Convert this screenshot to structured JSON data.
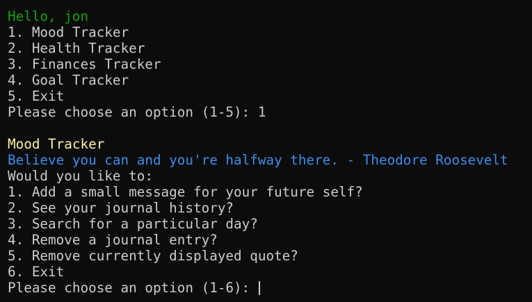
{
  "terminal": {
    "greeting": "Hello, jon",
    "main_menu": [
      "1. Mood Tracker",
      "2. Health Tracker",
      "3. Finances Tracker",
      "4. Goal Tracker",
      "5. Exit"
    ],
    "main_prompt": "Please choose an option (1-5): ",
    "main_input": "1",
    "section_title": "Mood Tracker",
    "quote": "Believe you can and you're halfway there. - Theodore Roosevelt",
    "submenu_intro": "Would you like to:",
    "mood_menu": [
      "1. Add a small message for your future self?",
      "2. See your journal history?",
      "3. Search for a particular day?",
      "4. Remove a journal entry?",
      "5. Remove currently displayed quote?",
      "6. Exit"
    ],
    "mood_prompt": "Please choose an option (1-6): ",
    "mood_input": ""
  },
  "colors": {
    "background": "#0c0c0c",
    "text": "#cccccc",
    "greeting": "#13a10e",
    "section_title": "#f9f1a5",
    "quote": "#3b8eea"
  }
}
